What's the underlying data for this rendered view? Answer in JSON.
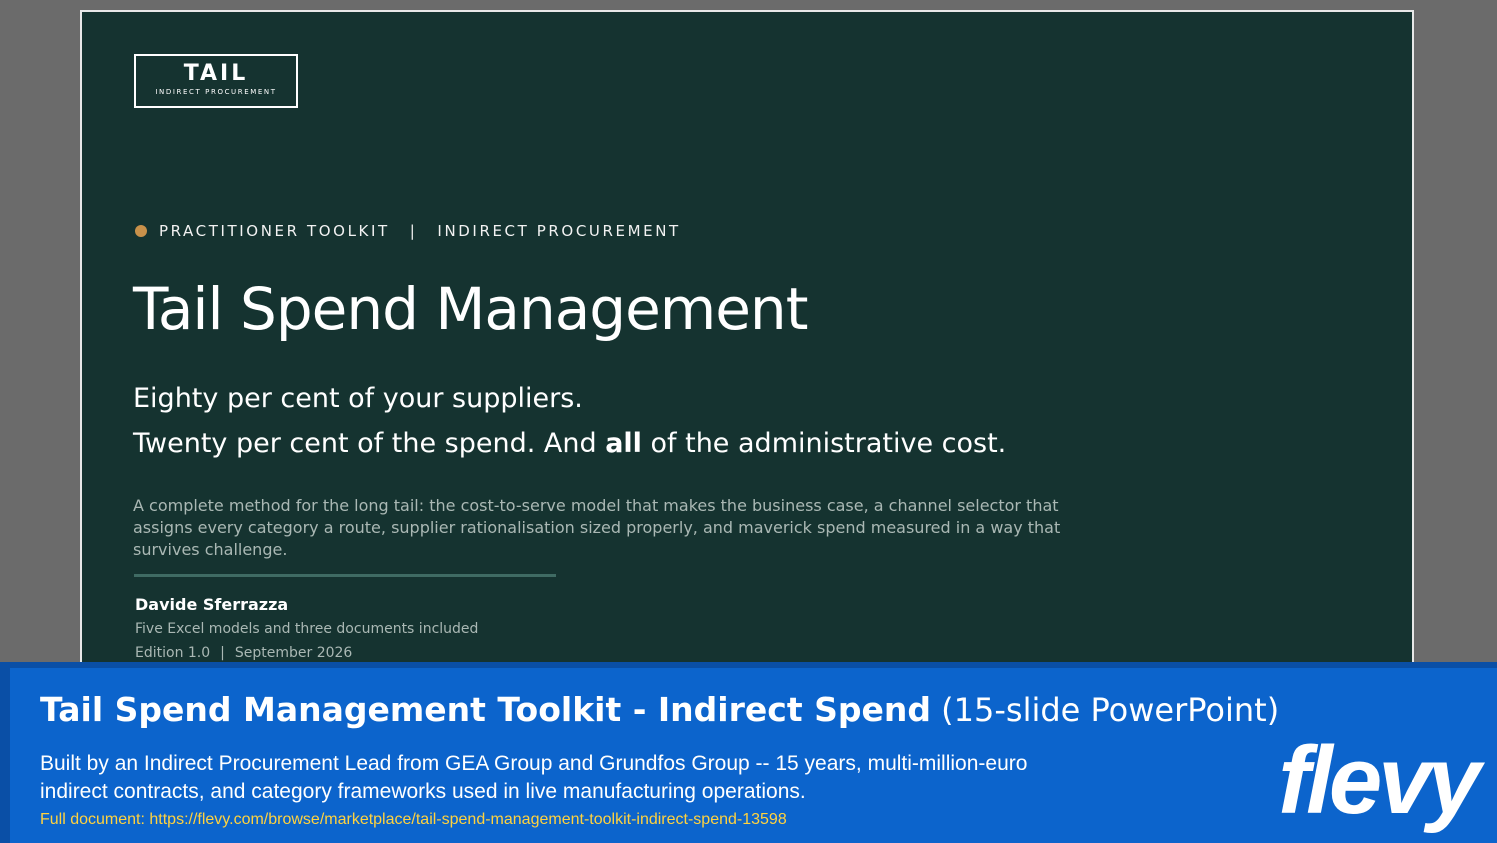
{
  "slide": {
    "logo": {
      "main": "TAIL",
      "sub": "INDIRECT PROCUREMENT"
    },
    "kicker": {
      "left": "PRACTITIONER TOOLKIT",
      "separator": "|",
      "right": "INDIRECT PROCUREMENT"
    },
    "title": "Tail Spend Management",
    "tagline_line1": "Eighty per cent of your suppliers.",
    "tagline_line2_before": "Twenty per cent of the spend. And ",
    "tagline_line2_bold": "all",
    "tagline_line2_after": " of the administrative cost.",
    "description": "A complete method for the long tail: the cost-to-serve model that makes the business case, a channel selector that assigns every category a route, supplier rationalisation sized properly, and maverick spend measured in a way that survives challenge.",
    "author": "Davide Sferrazza",
    "includes": "Five Excel models and three documents included",
    "edition": "Edition 1.0",
    "edition_separator": "|",
    "date": "September 2026"
  },
  "banner": {
    "title_bold": "Tail Spend Management Toolkit - Indirect Spend",
    "title_light": " (15-slide PowerPoint)",
    "description": "Built by an Indirect Procurement Lead from GEA Group and Grundfos Group -- 15 years, multi-million-euro indirect contracts, and category frameworks used in live manufacturing operations.",
    "link": "Full document: https://flevy.com/browse/marketplace/tail-spend-management-toolkit-indirect-spend-13598",
    "brand": "flevy"
  },
  "colors": {
    "slide_background": "#153330",
    "accent_dot": "#c8914a",
    "banner_blue": "#0c64cc",
    "link_yellow": "#ffd23f"
  }
}
